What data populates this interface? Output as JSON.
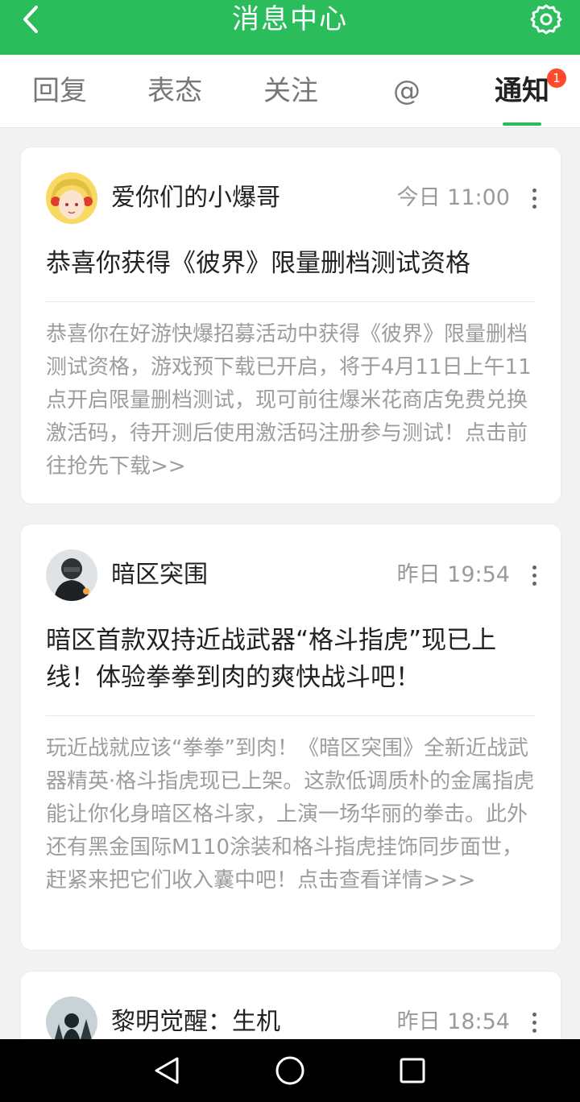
{
  "header": {
    "title": "消息中心",
    "back_icon": "back-arrow-icon",
    "settings_icon": "gear-icon"
  },
  "tabs": [
    {
      "label": "回复",
      "active": false
    },
    {
      "label": "表态",
      "active": false
    },
    {
      "label": "关注",
      "active": false
    },
    {
      "label": "@",
      "active": false
    },
    {
      "label": "通知",
      "active": true,
      "badge": "1"
    }
  ],
  "notifications": [
    {
      "sender": "爱你们的小爆哥",
      "time": "今日 11:00",
      "headline": "恭喜你获得《彼界》限量删档测试资格",
      "body": "恭喜你在好游快爆招募活动中获得《彼界》限量删档测试资格，游戏预下载已开启，将于4月11日上午11点开启限量删档测试，现可前往爆米花商店免费兑换激活码，待开测后使用激活码注册参与测试！点击前往抢先下载>>"
    },
    {
      "sender": "暗区突围",
      "time": "昨日 19:54",
      "headline": "暗区首款双持近战武器“格斗指虎”现已上线！体验拳拳到肉的爽快战斗吧！",
      "body": "玩近战就应该“拳拳”到肉！《暗区突围》全新近战武器精英·格斗指虎现已上架。这款低调质朴的金属指虎能让你化身暗区格斗家，上演一场华丽的拳击。此外还有黑金国际M110涂装和格斗指虎挂饰同步面世，赶紧来把它们收入囊中吧！点击查看详情>>>"
    },
    {
      "sender": "黎明觉醒：生机",
      "time": "昨日 18:54"
    }
  ],
  "colors": {
    "accent": "#2bbd5c",
    "badge": "#ff4a2c"
  },
  "nav": {
    "back_icon": "triangle-back-icon",
    "home_icon": "circle-home-icon",
    "recents_icon": "square-recents-icon"
  }
}
